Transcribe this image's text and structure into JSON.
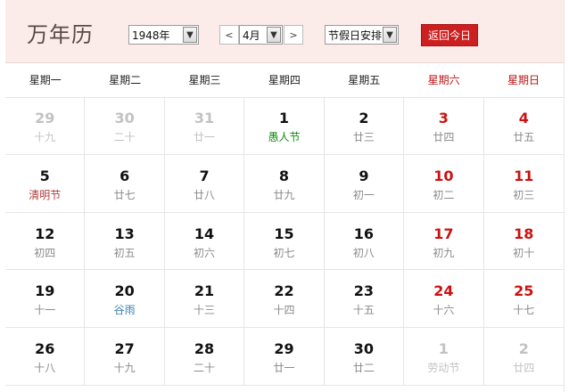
{
  "header": {
    "title": "万年历",
    "year_select": "1948年",
    "prev_label": "<",
    "month_select": "4月",
    "next_label": ">",
    "holiday_select": "节假日安排",
    "today_button": "返回今日"
  },
  "weekdays": [
    "星期一",
    "星期二",
    "星期三",
    "星期四",
    "星期五",
    "星期六",
    "星期日"
  ],
  "cells": [
    {
      "day": "29",
      "lunar": "十九",
      "type": "other"
    },
    {
      "day": "30",
      "lunar": "二十",
      "type": "other"
    },
    {
      "day": "31",
      "lunar": "廿一",
      "type": "other"
    },
    {
      "day": "1",
      "lunar": "愚人节",
      "type": "festival"
    },
    {
      "day": "2",
      "lunar": "廿三",
      "type": "normal"
    },
    {
      "day": "3",
      "lunar": "廿四",
      "type": "weekend"
    },
    {
      "day": "4",
      "lunar": "廿五",
      "type": "weekend"
    },
    {
      "day": "5",
      "lunar": "清明节",
      "type": "holiday"
    },
    {
      "day": "6",
      "lunar": "廿七",
      "type": "normal"
    },
    {
      "day": "7",
      "lunar": "廿八",
      "type": "normal"
    },
    {
      "day": "8",
      "lunar": "廿九",
      "type": "normal"
    },
    {
      "day": "9",
      "lunar": "初一",
      "type": "normal"
    },
    {
      "day": "10",
      "lunar": "初二",
      "type": "weekend"
    },
    {
      "day": "11",
      "lunar": "初三",
      "type": "weekend"
    },
    {
      "day": "12",
      "lunar": "初四",
      "type": "normal"
    },
    {
      "day": "13",
      "lunar": "初五",
      "type": "normal"
    },
    {
      "day": "14",
      "lunar": "初六",
      "type": "normal"
    },
    {
      "day": "15",
      "lunar": "初七",
      "type": "normal"
    },
    {
      "day": "16",
      "lunar": "初八",
      "type": "normal"
    },
    {
      "day": "17",
      "lunar": "初九",
      "type": "weekend"
    },
    {
      "day": "18",
      "lunar": "初十",
      "type": "weekend"
    },
    {
      "day": "19",
      "lunar": "十一",
      "type": "normal"
    },
    {
      "day": "20",
      "lunar": "谷雨",
      "type": "term"
    },
    {
      "day": "21",
      "lunar": "十三",
      "type": "normal"
    },
    {
      "day": "22",
      "lunar": "十四",
      "type": "normal"
    },
    {
      "day": "23",
      "lunar": "十五",
      "type": "normal"
    },
    {
      "day": "24",
      "lunar": "十六",
      "type": "weekend"
    },
    {
      "day": "25",
      "lunar": "十七",
      "type": "weekend"
    },
    {
      "day": "26",
      "lunar": "十八",
      "type": "normal"
    },
    {
      "day": "27",
      "lunar": "十九",
      "type": "normal"
    },
    {
      "day": "28",
      "lunar": "二十",
      "type": "normal"
    },
    {
      "day": "29",
      "lunar": "廿一",
      "type": "normal"
    },
    {
      "day": "30",
      "lunar": "廿二",
      "type": "normal"
    },
    {
      "day": "1",
      "lunar": "劳动节",
      "type": "other"
    },
    {
      "day": "2",
      "lunar": "廿四",
      "type": "other"
    }
  ],
  "colors": {
    "header_bg": "#fbecea",
    "weekend": "#cc1111",
    "festival": "#118811",
    "solar_term": "#3d7fb0",
    "holiday": "#b03a3a",
    "today_button": "#cc1f1f"
  }
}
